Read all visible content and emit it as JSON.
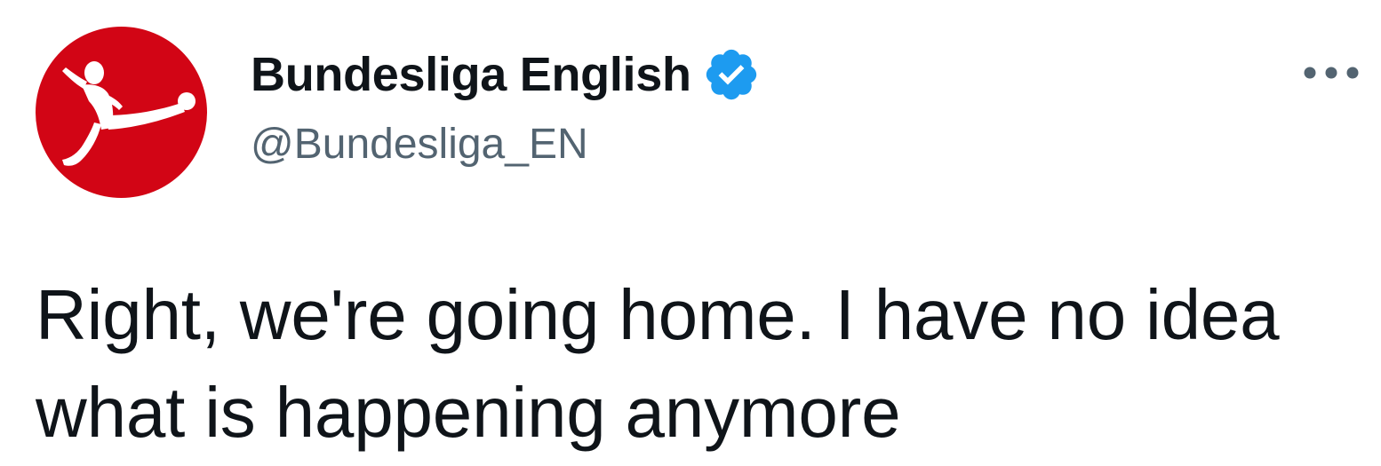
{
  "tweet": {
    "author": {
      "display_name": "Bundesliga English",
      "handle": "@Bundesliga_EN",
      "verified": true,
      "avatar_icon": "bundesliga-logo-icon",
      "avatar_color": "#d20515"
    },
    "more_icon": "more-options-icon",
    "text": "Right, we're going home. I have no idea what is happening anymore"
  },
  "colors": {
    "verified_blue": "#1d9bf0",
    "handle_gray": "#536471",
    "text": "#0f1419"
  }
}
